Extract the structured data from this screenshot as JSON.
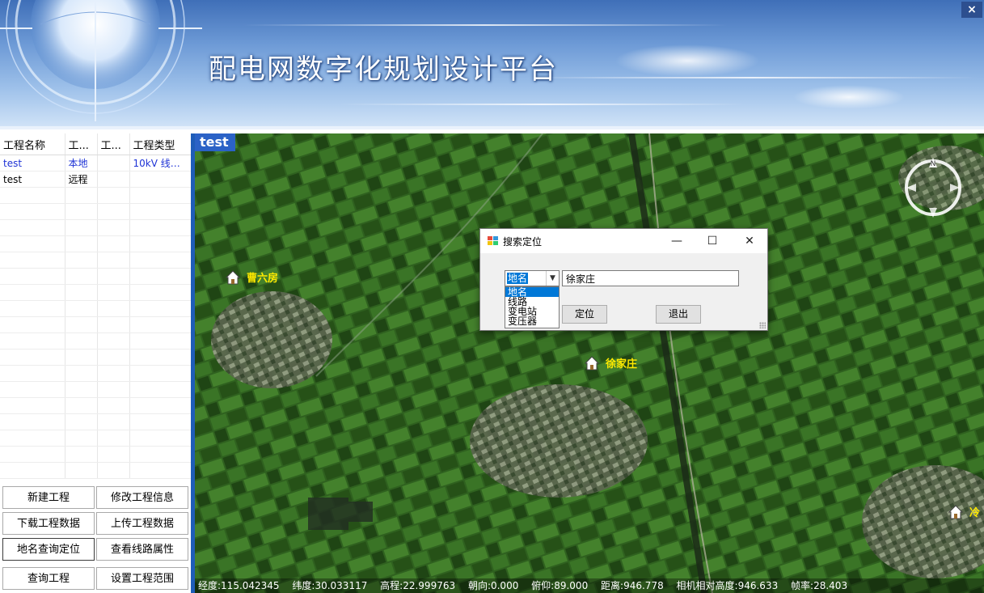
{
  "app": {
    "title": "配电网数字化规划设计平台",
    "close_glyph": "×"
  },
  "project_table": {
    "columns": [
      "工程名称",
      "工...",
      "工...",
      "工程类型"
    ],
    "rows": [
      {
        "name": "test",
        "c2": "本地",
        "c3": "",
        "type": "10kV 线路...",
        "selected": true
      },
      {
        "name": "test",
        "c2": "远程",
        "c3": "",
        "type": "",
        "selected": false
      }
    ]
  },
  "buttons": {
    "new_project": "新建工程",
    "edit_project": "修改工程信息",
    "download": "下载工程数据",
    "upload": "上传工程数据",
    "place_search": "地名查询定位",
    "line_props": "查看线路属性",
    "query": "查询工程",
    "set_range": "设置工程范围"
  },
  "map": {
    "tag": "test",
    "places": [
      "曹六房",
      "徐家庄",
      "冷"
    ],
    "compass_label": "N",
    "status": {
      "lon": "经度:115.042345",
      "lat": "纬度:30.033117",
      "elev": "高程:22.999763",
      "heading": "朝向:0.000",
      "pitch": "俯仰:89.000",
      "dist": "距离:946.778",
      "cam_height": "相机相对高度:946.633",
      "fps": "帧率:28.403"
    }
  },
  "dialog": {
    "title": "搜索定位",
    "minimize": "—",
    "maximize": "☐",
    "close": "✕",
    "type_selected": "地名",
    "type_options": [
      "地名",
      "线路",
      "变电站",
      "变压器"
    ],
    "search_value": "徐家庄",
    "locate_label": "定位",
    "exit_label": "退出"
  },
  "colors": {
    "selected_row": "#1e33d6",
    "map_border": "#1f5db8",
    "place_label": "#ffea00",
    "highlight": "#0078d7"
  }
}
